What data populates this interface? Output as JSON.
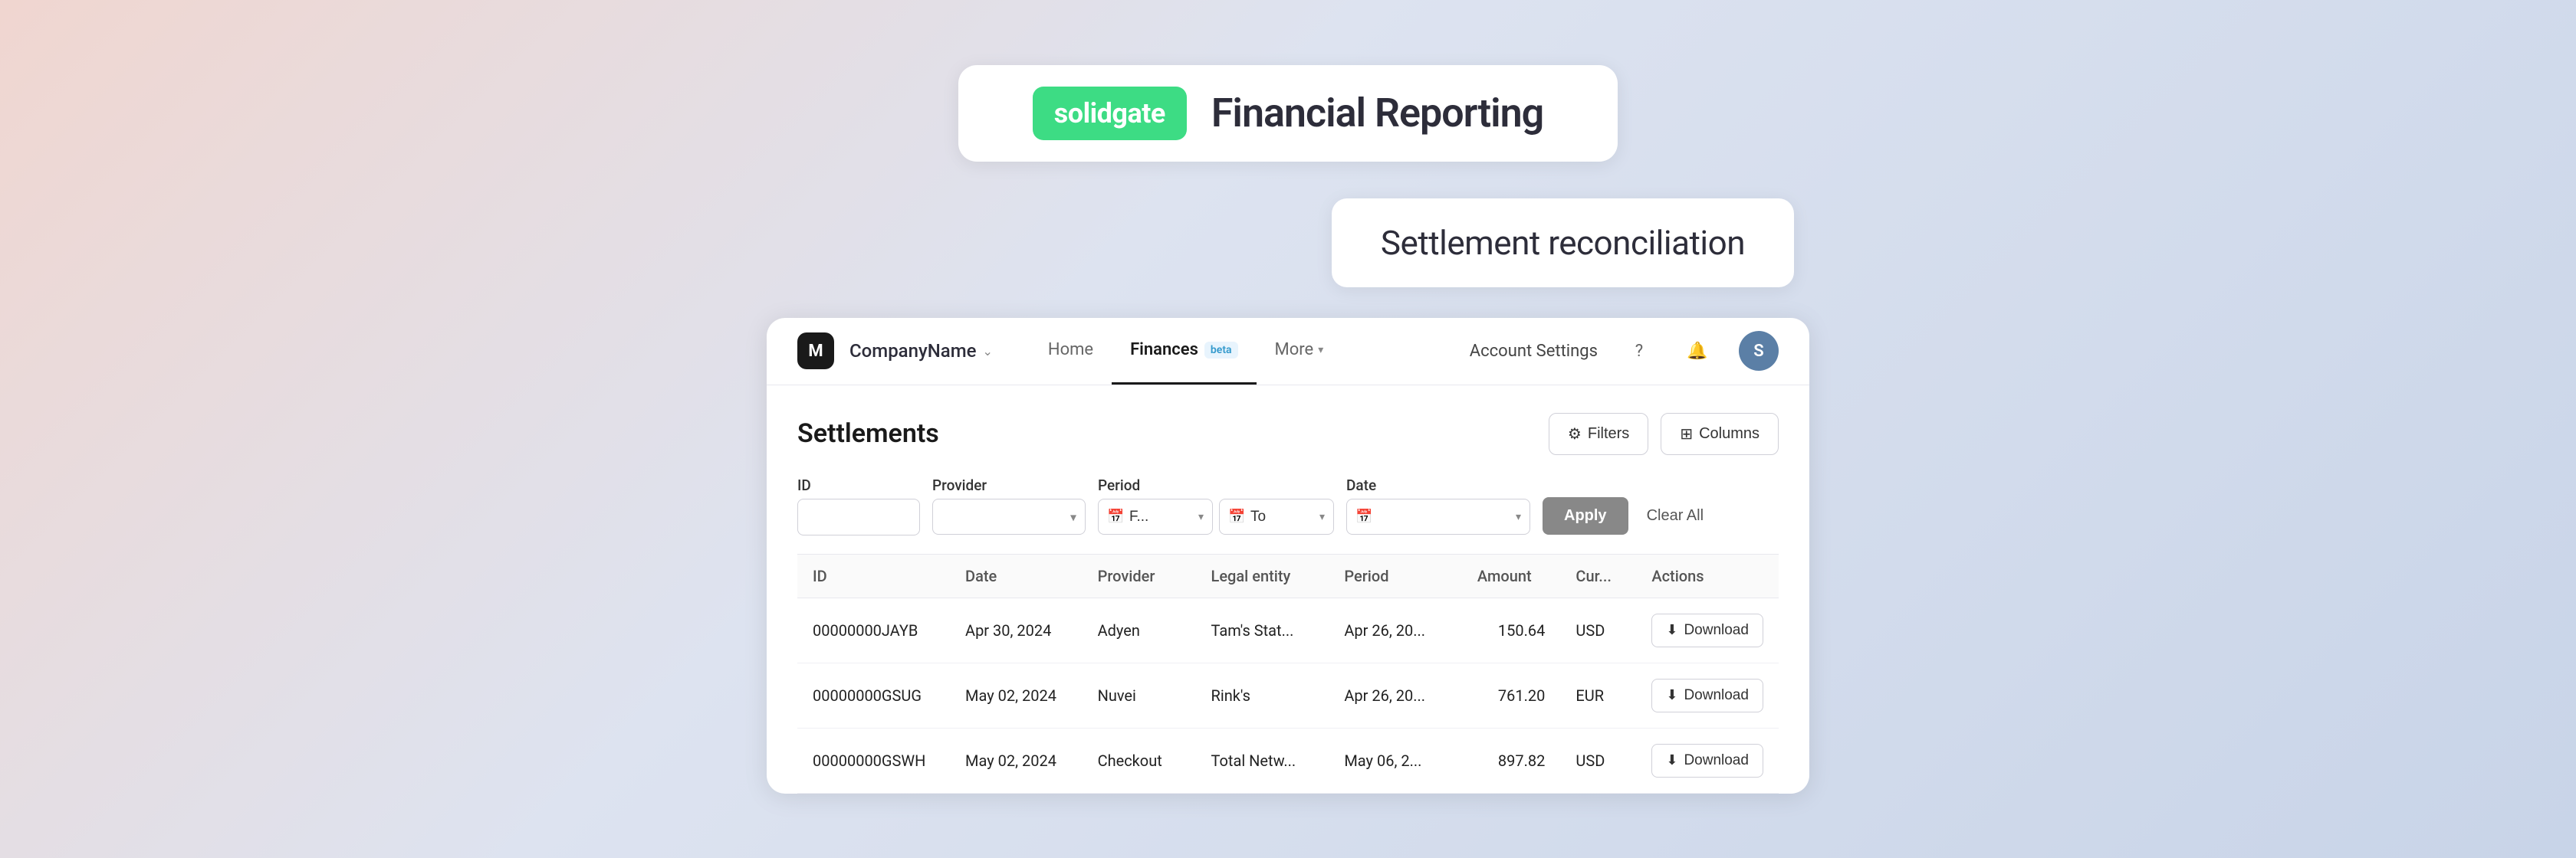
{
  "logo": {
    "badge": "solidgate",
    "title": "Financial Reporting"
  },
  "reconciliation": {
    "title": "Settlement reconciliation"
  },
  "nav": {
    "logo_letter": "M",
    "company_name": "CompanyName",
    "items": [
      {
        "label": "Home",
        "active": false
      },
      {
        "label": "Finances",
        "active": true,
        "badge": "beta"
      },
      {
        "label": "More",
        "active": false,
        "has_chevron": true
      }
    ],
    "right": {
      "account_settings": "Account Settings",
      "user_initial": "S"
    }
  },
  "settlements": {
    "title": "Settlements",
    "filters_btn": "Filters",
    "columns_btn": "Columns",
    "filters": {
      "id_label": "ID",
      "id_placeholder": "",
      "provider_label": "Provider",
      "provider_placeholder": "",
      "period_label": "Period",
      "period_from": "F...",
      "period_to": "To",
      "date_label": "Date",
      "apply_btn": "Apply",
      "clear_btn": "Clear All"
    },
    "table": {
      "columns": [
        "ID",
        "Date",
        "Provider",
        "Legal entity",
        "Period",
        "Amount",
        "Cur...",
        "Actions"
      ],
      "rows": [
        {
          "id": "00000000JAYB",
          "date": "Apr 30, 2024",
          "provider": "Adyen",
          "entity": "Tam's Stat...",
          "period": "Apr 26, 20...",
          "amount": "150.64",
          "currency": "USD",
          "action": "Download"
        },
        {
          "id": "00000000GSUG",
          "date": "May 02, 2024",
          "provider": "Nuvei",
          "entity": "Rink's",
          "period": "Apr 26, 20...",
          "amount": "761.20",
          "currency": "EUR",
          "action": "Download"
        },
        {
          "id": "00000000GSWH",
          "date": "May 02, 2024",
          "provider": "Checkout",
          "entity": "Total Netw...",
          "period": "May 06, 2...",
          "amount": "897.82",
          "currency": "USD",
          "action": "Download"
        }
      ]
    }
  }
}
